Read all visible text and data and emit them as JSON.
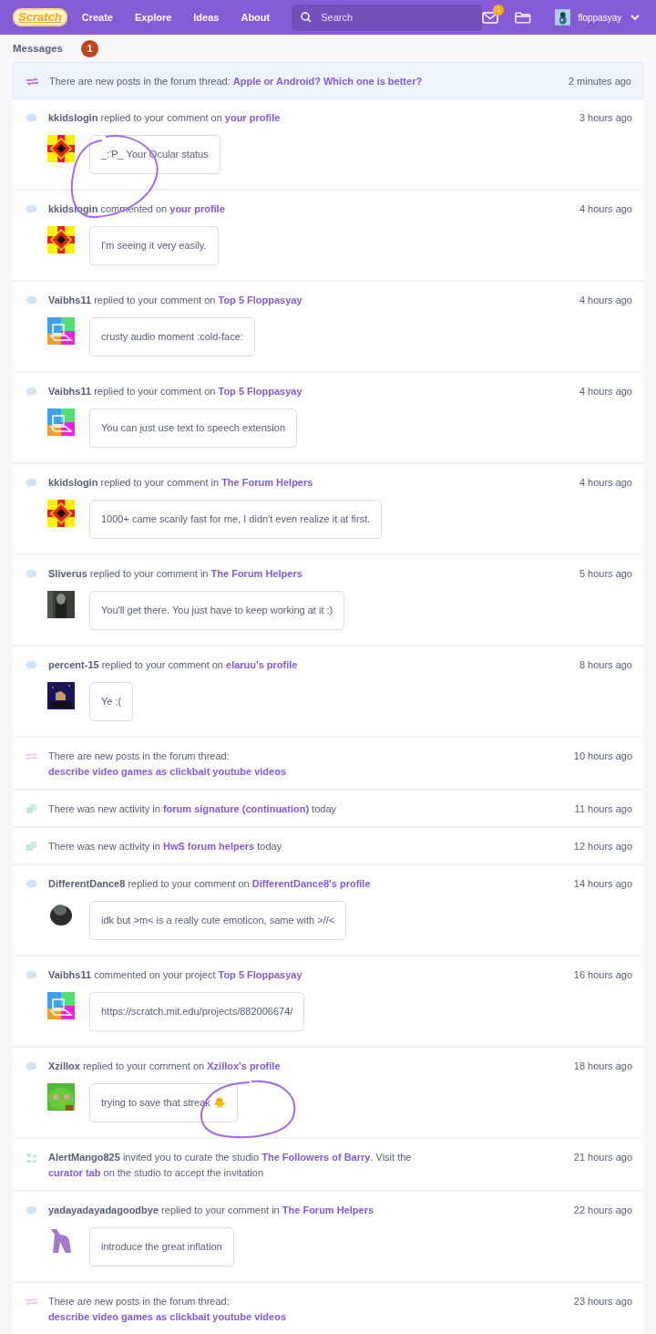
{
  "nav": {
    "logo": "Scratch",
    "links": [
      "Create",
      "Explore",
      "Ideas",
      "About"
    ],
    "search": {
      "placeholder": "Search"
    },
    "mail_badge": "1",
    "username": "floppasyay"
  },
  "heading": {
    "title": "Messages",
    "count": "1"
  },
  "messages": [
    {
      "kind": "forum",
      "unread": true,
      "text": [
        {
          "kind": "plain",
          "text": "There are new posts in the forum thread: "
        },
        {
          "kind": "link",
          "text": "Apple or Android? Which one is better?"
        }
      ],
      "time": "2 minutes ago"
    },
    {
      "kind": "comment",
      "unread": false,
      "text": [
        {
          "kind": "user",
          "text": "kkidslogin"
        },
        {
          "kind": "plain",
          "text": " replied to your comment on "
        },
        {
          "kind": "link",
          "text": "your profile"
        }
      ],
      "time": "3 hours ago",
      "comment": "_:'P_ Your Ocular status"
    },
    {
      "kind": "comment",
      "unread": false,
      "text": [
        {
          "kind": "user",
          "text": "kkidslogin"
        },
        {
          "kind": "plain",
          "text": " commented on "
        },
        {
          "kind": "link",
          "text": "your profile"
        }
      ],
      "time": "4 hours ago",
      "comment": "I'm seeing it very easily."
    },
    {
      "kind": "comment",
      "unread": false,
      "text": [
        {
          "kind": "user",
          "text": "Vaibhs11"
        },
        {
          "kind": "plain",
          "text": " replied to your comment on "
        },
        {
          "kind": "link",
          "text": "Top 5 Floppasyay"
        }
      ],
      "time": "4 hours ago",
      "comment": "crusty audio moment :cold-face:"
    },
    {
      "kind": "comment",
      "unread": false,
      "text": [
        {
          "kind": "user",
          "text": "Vaibhs11"
        },
        {
          "kind": "plain",
          "text": " replied to your comment on "
        },
        {
          "kind": "link",
          "text": "Top 5 Floppasyay"
        }
      ],
      "time": "4 hours ago",
      "comment": "You can just use text to speech extension"
    },
    {
      "kind": "comment",
      "unread": false,
      "text": [
        {
          "kind": "user",
          "text": "kkidslogin"
        },
        {
          "kind": "plain",
          "text": " replied to your comment in "
        },
        {
          "kind": "link",
          "text": "The Forum Helpers"
        }
      ],
      "time": "4 hours ago",
      "comment": "1000+ came scarily fast for me, I didn't even realize it at first."
    },
    {
      "kind": "comment",
      "unread": false,
      "text": [
        {
          "kind": "user",
          "text": "Sliverus"
        },
        {
          "kind": "plain",
          "text": " replied to your comment in "
        },
        {
          "kind": "link",
          "text": "The Forum Helpers"
        }
      ],
      "time": "5 hours ago",
      "comment": "You'll get there. You just have to keep working at it :)"
    },
    {
      "kind": "comment",
      "unread": false,
      "text": [
        {
          "kind": "user",
          "text": "percent-15"
        },
        {
          "kind": "plain",
          "text": " replied to your comment on "
        },
        {
          "kind": "link",
          "text": "elaruu's profile"
        }
      ],
      "time": "8 hours ago",
      "comment": "Ye :("
    },
    {
      "kind": "forum",
      "unread": false,
      "text": [
        {
          "kind": "plain",
          "text": "There are new posts in the forum thread: "
        },
        {
          "kind": "link",
          "text": "describe video games as clickbait youtube videos"
        }
      ],
      "time": "10 hours ago"
    },
    {
      "kind": "activity",
      "unread": false,
      "text": [
        {
          "kind": "plain",
          "text": "There was new activity in "
        },
        {
          "kind": "link",
          "text": "forum signature (continuation)"
        },
        {
          "kind": "plain",
          "text": " today"
        }
      ],
      "time": "11 hours ago"
    },
    {
      "kind": "activity",
      "unread": false,
      "text": [
        {
          "kind": "plain",
          "text": "There was new activity in "
        },
        {
          "kind": "link",
          "text": "HwS forum helpers"
        },
        {
          "kind": "plain",
          "text": " today"
        }
      ],
      "time": "12 hours ago"
    },
    {
      "kind": "comment",
      "unread": false,
      "text": [
        {
          "kind": "user",
          "text": "DifferentDance8"
        },
        {
          "kind": "plain",
          "text": " replied to your comment on "
        },
        {
          "kind": "link",
          "text": "DifferentDance8's profile"
        }
      ],
      "time": "14 hours ago",
      "comment": "idk but >m< is a really cute emoticon, same with >//<"
    },
    {
      "kind": "comment",
      "unread": false,
      "text": [
        {
          "kind": "user",
          "text": "Vaibhs11"
        },
        {
          "kind": "plain",
          "text": " commented on your project "
        },
        {
          "kind": "link",
          "text": "Top 5 Floppasyay"
        }
      ],
      "time": "16 hours ago",
      "comment": "https://scratch.mit.edu/projects/882006674/"
    },
    {
      "kind": "comment",
      "unread": false,
      "text": [
        {
          "kind": "user",
          "text": "Xzillox"
        },
        {
          "kind": "plain",
          "text": " replied to your comment on "
        },
        {
          "kind": "link",
          "text": "Xzillox's profile"
        }
      ],
      "time": "18 hours ago",
      "comment": "trying to save that streak 🐥"
    },
    {
      "kind": "invite",
      "unread": false,
      "text": [
        {
          "kind": "user",
          "text": "AlertMango825"
        },
        {
          "kind": "plain",
          "text": " invited you to curate the studio "
        },
        {
          "kind": "link",
          "text": "The Followers of Barry"
        },
        {
          "kind": "plain",
          "text": ". Visit the "
        },
        {
          "kind": "link",
          "text": "curator tab"
        },
        {
          "kind": "plain",
          "text": " on the studio to accept the invitation"
        }
      ],
      "time": "21 hours ago"
    },
    {
      "kind": "comment",
      "unread": false,
      "text": [
        {
          "kind": "user",
          "text": "yadayadayadagoodbye"
        },
        {
          "kind": "plain",
          "text": " replied to your comment in "
        },
        {
          "kind": "link",
          "text": "The Forum Helpers"
        }
      ],
      "time": "22 hours ago",
      "comment": "introduce the great inflation"
    },
    {
      "kind": "forum",
      "unread": false,
      "text": [
        {
          "kind": "plain",
          "text": "There are new posts in the forum thread: "
        },
        {
          "kind": "link",
          "text": "describe video games as clickbait youtube videos"
        }
      ],
      "time": "23 hours ago"
    }
  ]
}
